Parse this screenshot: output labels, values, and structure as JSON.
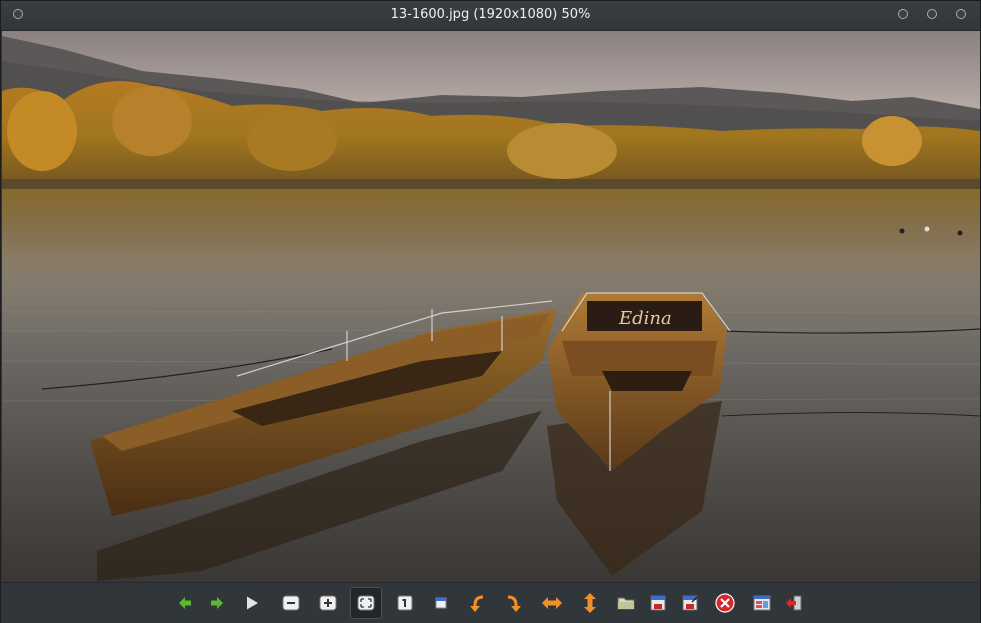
{
  "window": {
    "title": "13-1600.jpg (1920x1080) 50%"
  },
  "image": {
    "boat_name": "Edina"
  },
  "toolbar": {
    "items": [
      {
        "icon": "arrow-left-icon",
        "action": "previous"
      },
      {
        "icon": "arrow-right-icon",
        "action": "next"
      },
      {
        "icon": "play-icon",
        "action": "slideshow"
      },
      {
        "icon": "zoom-out-icon",
        "action": "zoom-out"
      },
      {
        "icon": "zoom-in-icon",
        "action": "zoom-in"
      },
      {
        "icon": "fit-window-icon",
        "action": "fit",
        "active": true
      },
      {
        "icon": "original-size-icon",
        "action": "1:1"
      },
      {
        "icon": "fullscreen-icon",
        "action": "fullscreen"
      },
      {
        "icon": "rotate-left-icon",
        "action": "rotate-left"
      },
      {
        "icon": "rotate-right-icon",
        "action": "rotate-right"
      },
      {
        "icon": "flip-horizontal-icon",
        "action": "flip-h"
      },
      {
        "icon": "flip-vertical-icon",
        "action": "flip-v"
      },
      {
        "icon": "open-folder-icon",
        "action": "open"
      },
      {
        "icon": "save-icon",
        "action": "save"
      },
      {
        "icon": "save-as-icon",
        "action": "save-as"
      },
      {
        "icon": "delete-icon",
        "action": "delete"
      },
      {
        "icon": "preferences-icon",
        "action": "preferences"
      },
      {
        "icon": "exit-icon",
        "action": "quit"
      }
    ]
  },
  "colors": {
    "titlebar": "#31363b",
    "toolbar": "#31363b",
    "arrow_green": "#5cb82e",
    "orange_arrow": "#f0902a",
    "delete_red": "#d8262a"
  }
}
